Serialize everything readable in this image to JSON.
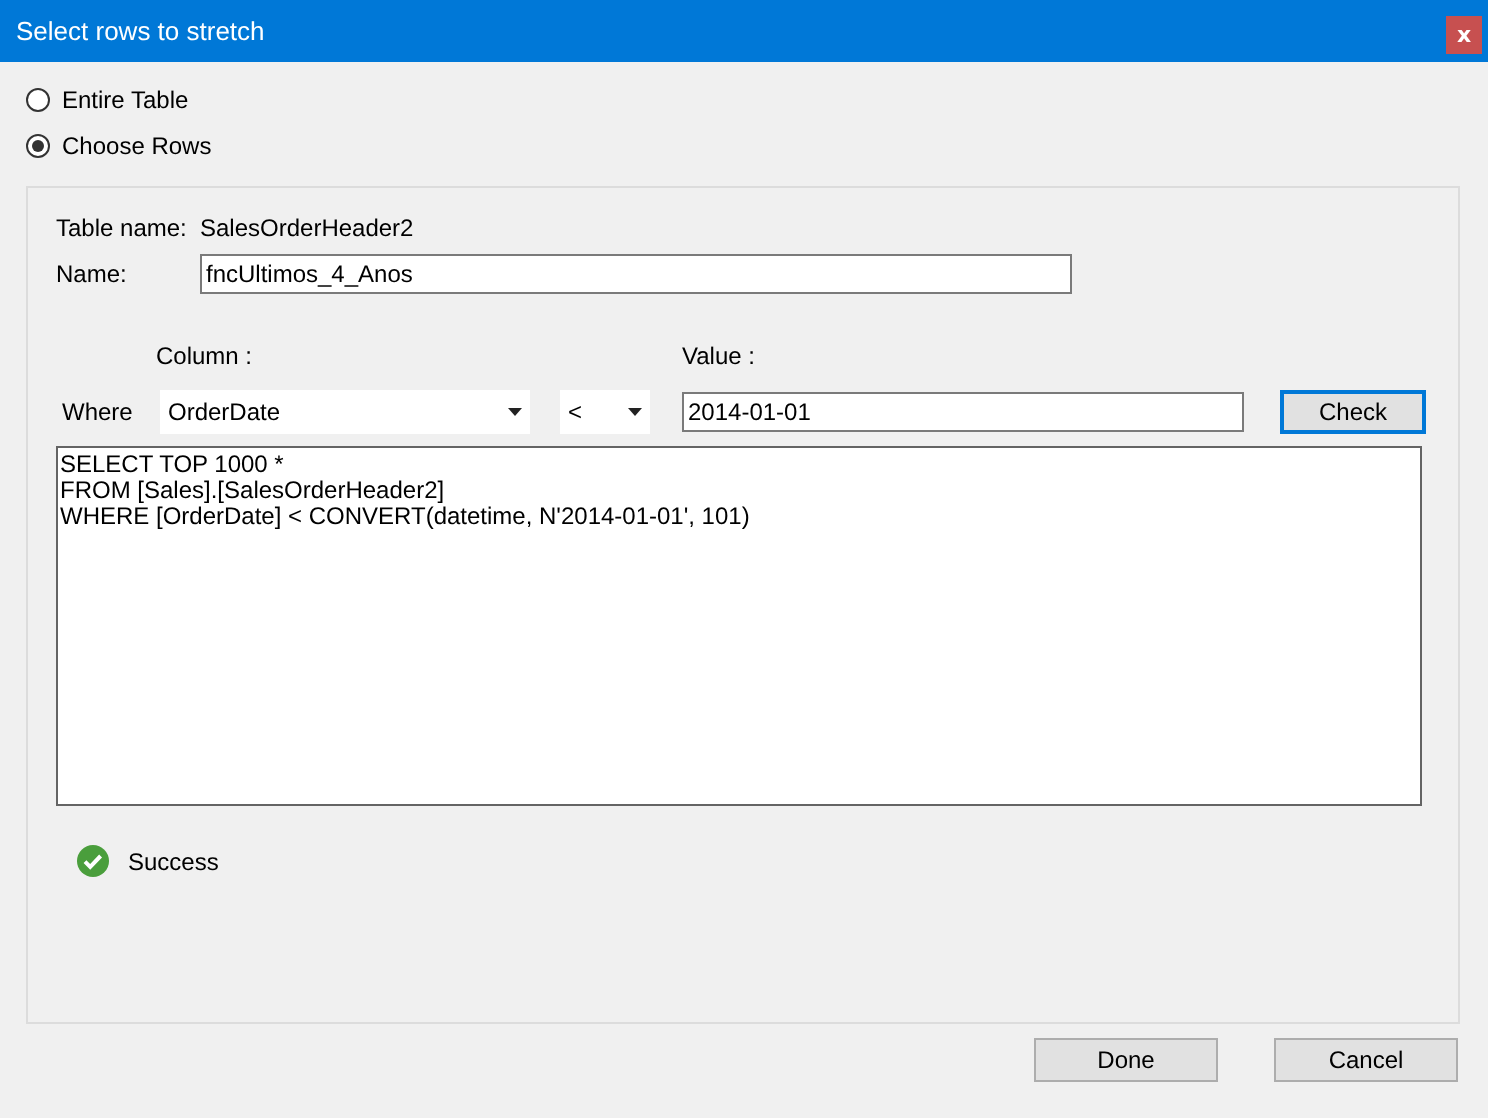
{
  "window": {
    "title": "Select rows to stretch",
    "close": "x"
  },
  "scope_options": [
    {
      "label": "Entire Table",
      "selected": false
    },
    {
      "label": "Choose Rows",
      "selected": true
    }
  ],
  "table_name": {
    "label": "Table name:",
    "value": "SalesOrderHeader2"
  },
  "name": {
    "label": "Name:",
    "value": "fncUltimos_4_Anos"
  },
  "filter": {
    "column_label": "Column :",
    "value_label": "Value :",
    "where_label": "Where",
    "column": "OrderDate",
    "operator": "<",
    "value": "2014-01-01",
    "check": "Check"
  },
  "query": [
    "SELECT TOP 1000 *",
    "FROM [Sales].[SalesOrderHeader2]",
    "WHERE [OrderDate] < CONVERT(datetime, N'2014-01-01', 101)"
  ],
  "status": {
    "kind": "success",
    "text": "Success"
  },
  "buttons": [
    "Done",
    "Cancel"
  ]
}
